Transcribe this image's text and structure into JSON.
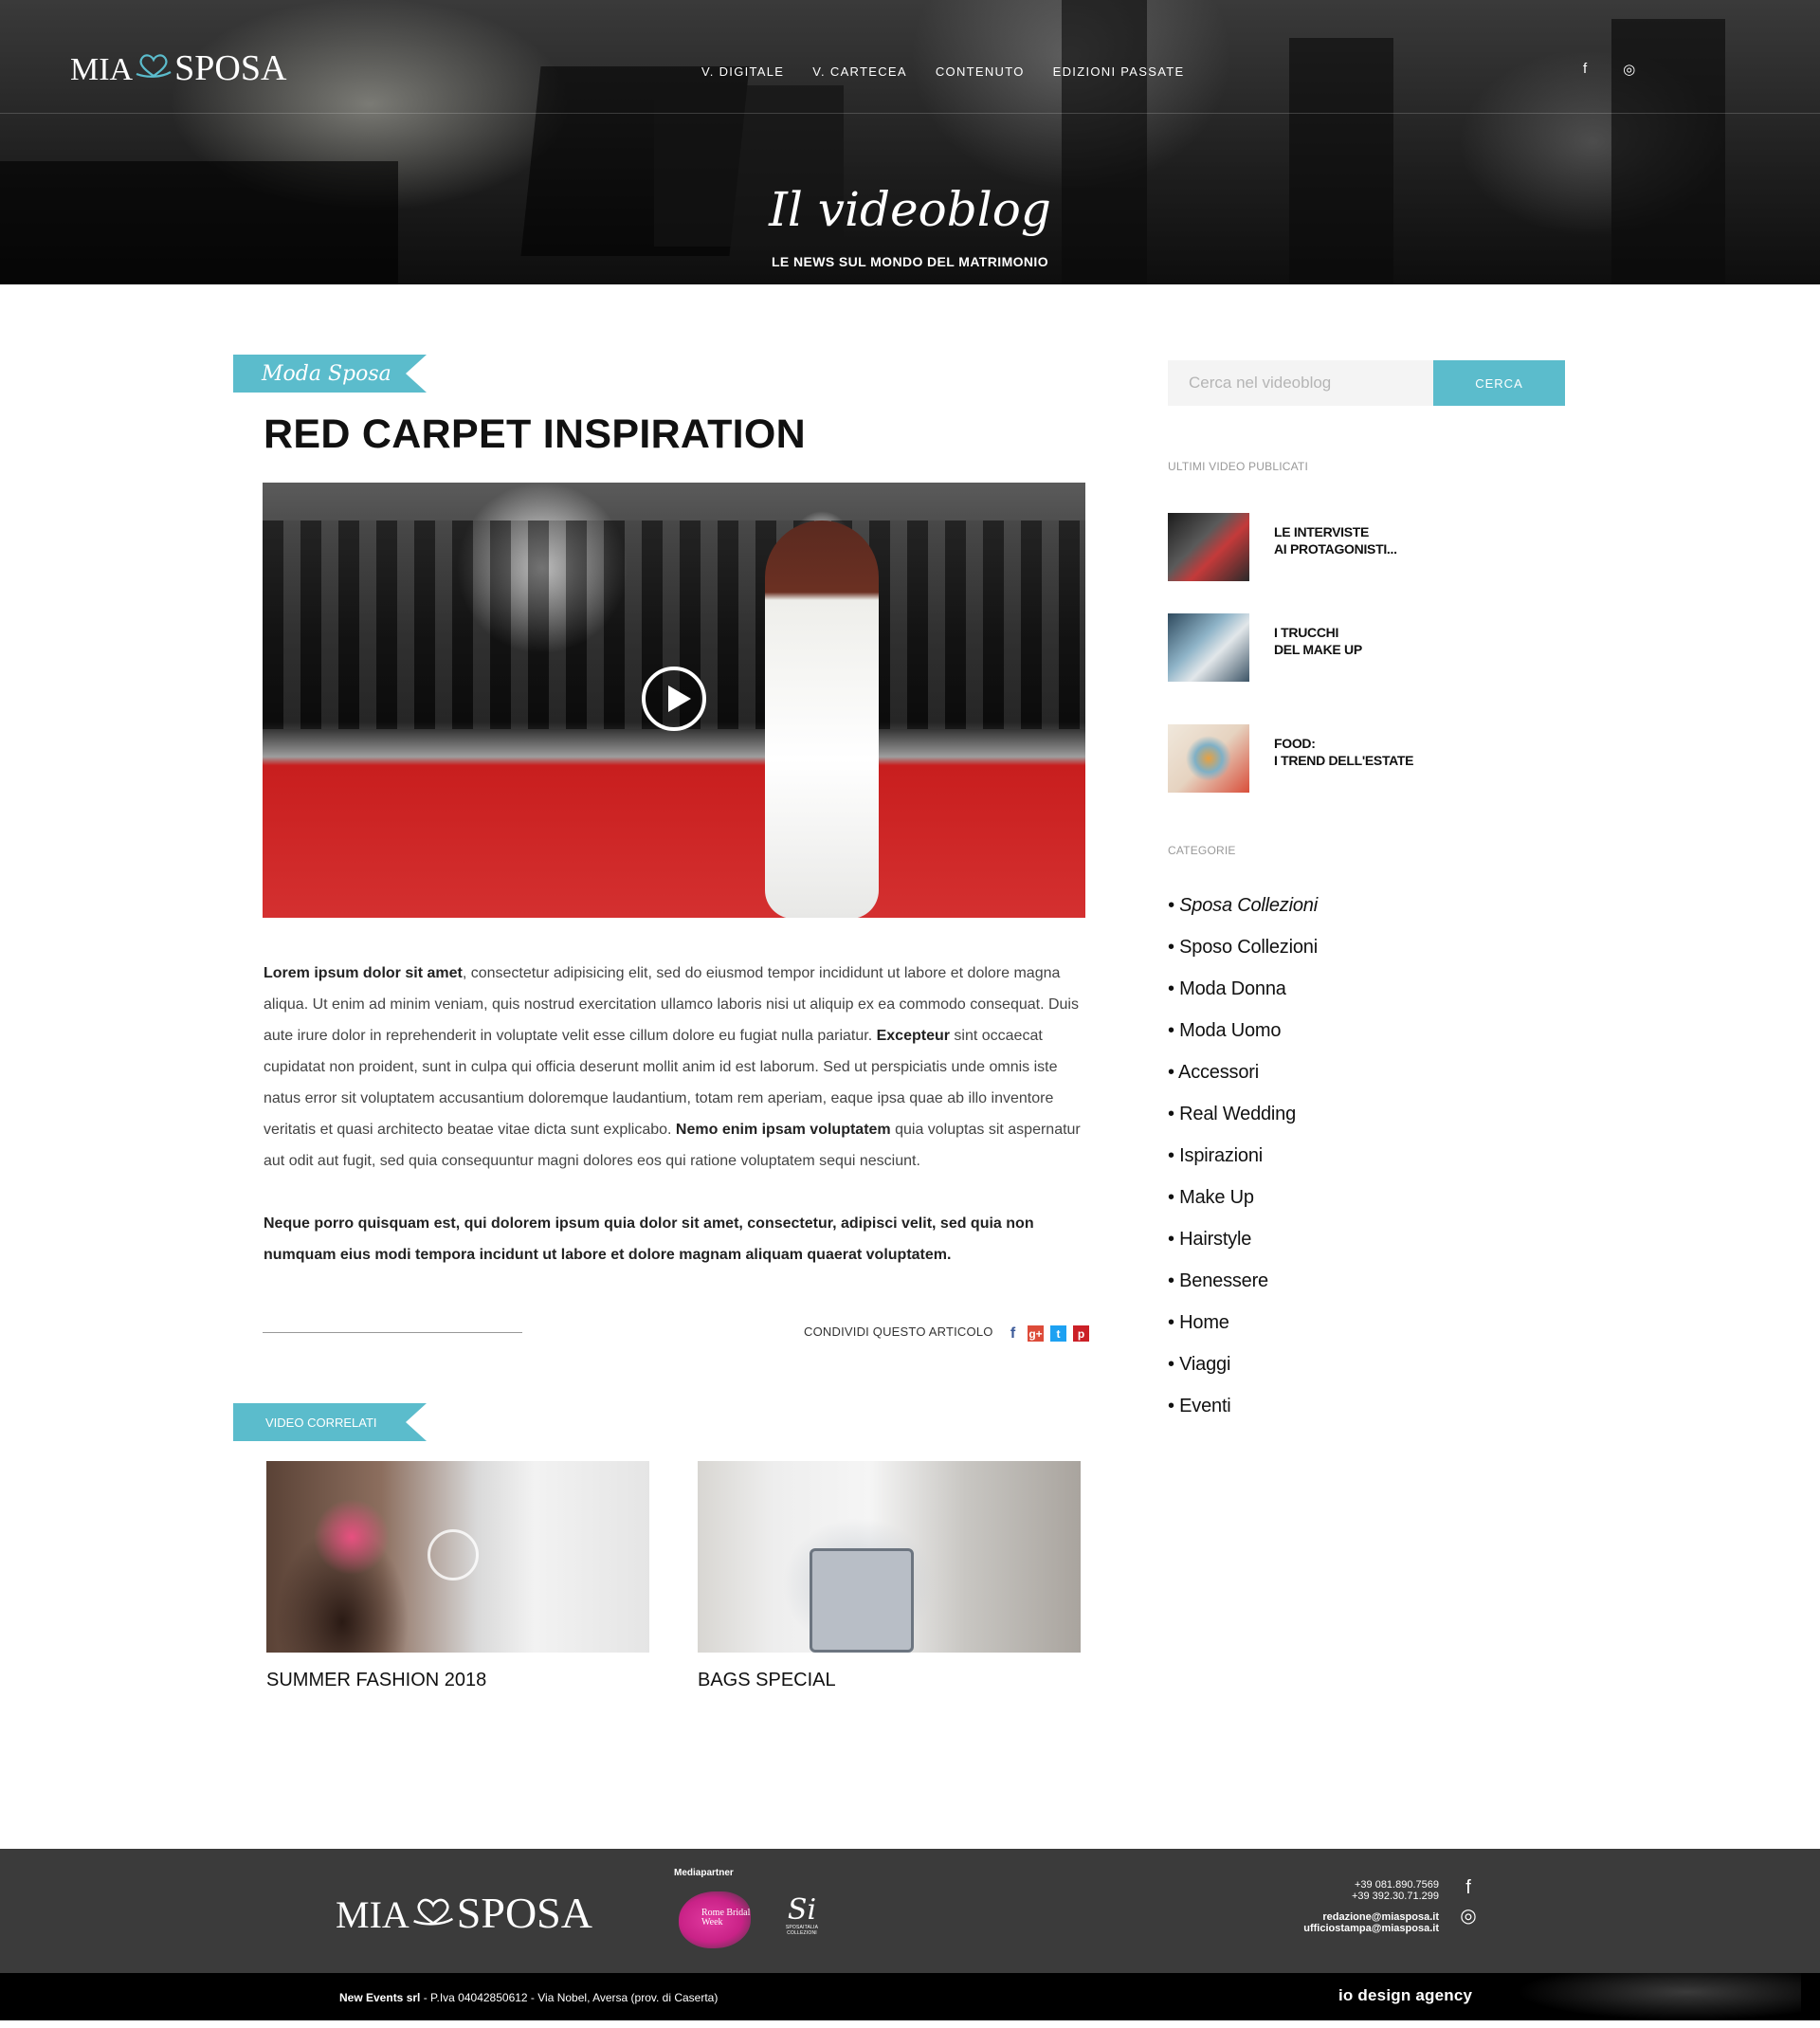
{
  "brand": {
    "mia": "MIA",
    "sposa": "SPOSA"
  },
  "nav": [
    {
      "label": "V. DIGITALE"
    },
    {
      "label": "V. CARTECEA"
    },
    {
      "label": "CONTENUTO"
    },
    {
      "label": "EDIZIONI PASSATE"
    }
  ],
  "social_top": [
    {
      "icon": "facebook-icon",
      "glyph": "f"
    },
    {
      "icon": "instagram-icon",
      "glyph": "◎"
    }
  ],
  "hero": {
    "title": "Il videoblog",
    "subtitle": "LE NEWS SUL MONDO DEL MATRIMONIO"
  },
  "article": {
    "category": "Moda Sposa",
    "title": "RED CARPET INSPIRATION",
    "p1_b1": "Lorem ipsum dolor sit amet",
    "p1_t1": ", consectetur adipisicing elit, sed do eiusmod tempor incididunt ut labore et dolore magna aliqua. Ut enim ad minim veniam, quis nostrud exercitation ullamco laboris nisi ut aliquip ex ea commodo consequat. Duis aute irure dolor in reprehenderit in voluptate velit esse cillum dolore eu fugiat nulla pariatur. ",
    "p1_b2": "Excepteur",
    "p1_t2": " sint occaecat cupidatat non proident, sunt in culpa qui officia deserunt mollit anim id est laborum. Sed ut perspiciatis unde omnis iste natus error sit voluptatem accusantium doloremque laudantium, totam rem aperiam, eaque ipsa quae ab illo inventore veritatis et quasi architecto beatae vitae dicta sunt explicabo. ",
    "p1_b3": "Nemo enim ipsam voluptatem",
    "p1_t3": " quia voluptas sit aspernatur aut odit aut fugit, sed quia consequuntur magni dolores eos qui ratione voluptatem sequi nesciunt.",
    "p2": "Neque porro quisquam est, qui dolorem ipsum quia dolor sit amet, consectetur, adipisci velit, sed quia non numquam eius modi tempora incidunt ut labore et dolore magnam aliquam quaerat voluptatem.",
    "share_label": "CONDIVIDI QUESTO ARTICOLO",
    "share_icons": [
      {
        "icon": "facebook-icon",
        "glyph": "f"
      },
      {
        "icon": "google-plus-icon",
        "glyph": "g+"
      },
      {
        "icon": "twitter-icon",
        "glyph": "t"
      },
      {
        "icon": "pinterest-icon",
        "glyph": "p"
      }
    ]
  },
  "related": {
    "heading": "VIDEO CORRELATI",
    "items": [
      {
        "title": "SUMMER FASHION 2018"
      },
      {
        "title": "BAGS SPECIAL"
      }
    ]
  },
  "sidebar": {
    "search": {
      "placeholder": "Cerca nel videoblog",
      "button": "CERCA"
    },
    "latest_heading": "ULTIMI VIDEO PUBLICATI",
    "latest": [
      {
        "title": "LE INTERVISTE\nAI PROTAGONISTI..."
      },
      {
        "title": "I TRUCCHI\nDEL MAKE UP"
      },
      {
        "title": "FOOD:\nI TREND DELL'ESTATE"
      }
    ],
    "categories_heading": "CATEGORIE",
    "categories": [
      "• Sposa Collezioni",
      "• Sposo Collezioni",
      "• Moda Donna",
      "• Moda Uomo",
      "• Accessori",
      "• Real Wedding",
      "• Ispirazioni",
      "• Make Up",
      "• Hairstyle",
      "• Benessere",
      "• Home",
      "• Viaggi",
      "• Eventi"
    ],
    "active_category": 0
  },
  "footer": {
    "media_partner_label": "Mediapartner",
    "partner1": "Rome Bridal Week",
    "partner2_logo": "Si",
    "partner2_caption": "SPOSAITALIA COLLEZIONI",
    "phone1": "+39 081.890.7569",
    "phone2": "+39 392.30.71.299",
    "email1": "redazione@miasposa.it",
    "email2": "ufficiostampa@miasposa.it",
    "company_name": "New Events srl",
    "company_details": " - P.Iva 04042850612 - Via Nobel, Aversa (prov. di Caserta)",
    "agency": "io design agency"
  },
  "colors": {
    "accent": "#5bbccc",
    "logo_heart": "#5bbccc",
    "footer_bg": "#3b3b3b"
  }
}
